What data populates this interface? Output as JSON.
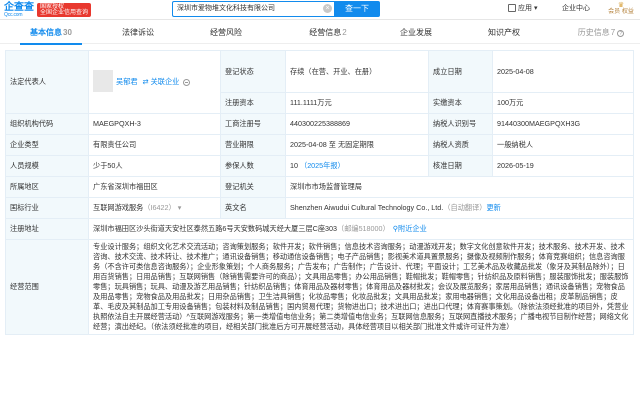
{
  "header": {
    "logo_main": "企查查",
    "logo_sub": "Qcc.com",
    "badge_top": "国家授权",
    "badge_bottom": "全国企业信用查询",
    "search_value": "深圳市爱物堆文化科技有限公司",
    "search_button": "查一下",
    "app_label": "应用",
    "center_label": "企业中心",
    "vip_label": "会员 权益"
  },
  "tabs": [
    {
      "label": "基本信息",
      "count": "30"
    },
    {
      "label": "法律诉讼",
      "count": ""
    },
    {
      "label": "经营风险",
      "count": ""
    },
    {
      "label": "经营信息",
      "count": "2"
    },
    {
      "label": "企业发展",
      "count": ""
    },
    {
      "label": "知识产权",
      "count": ""
    },
    {
      "label": "历史信息",
      "count": "7"
    }
  ],
  "info": {
    "legal_rep_label": "法定代表人",
    "legal_rep_name": "吴郁君",
    "legal_rep_link": "关联企业",
    "status_label": "登记状态",
    "status_value": "存续（在营、开业、在册）",
    "est_date_label": "成立日期",
    "est_date_value": "2025-04-08",
    "reg_capital_label": "注册资本",
    "reg_capital_value": "111.1111万元",
    "paid_capital_label": "实缴资本",
    "paid_capital_value": "100万元",
    "org_code_label": "组织机构代码",
    "org_code_value": "MAEGPQXH-3",
    "biz_reg_label": "工商注册号",
    "biz_reg_value": "440300225388869",
    "taxpayer_id_label": "纳税人识别号",
    "taxpayer_id_value": "91440300MAEGPQXH3G",
    "type_label": "企业类型",
    "type_value": "有限责任公司",
    "term_label": "营业期限",
    "term_value": "2025-04-08 至 无固定期限",
    "taxpayer_q_label": "纳税人资质",
    "taxpayer_q_value": "一般纳税人",
    "staff_label": "人员规模",
    "staff_value": "少于50人",
    "insured_label": "参保人数",
    "insured_value": "10",
    "insured_year": "（2025年报）",
    "approval_label": "核准日期",
    "approval_value": "2026-05-19",
    "region_label": "所属地区",
    "region_value": "广东省深圳市福田区",
    "authority_label": "登记机关",
    "authority_value": "深圳市市场监督管理局",
    "industry_label": "国标行业",
    "industry_value": "互联网游戏服务",
    "industry_code": "（I6422）",
    "english_label": "英文名",
    "english_value": "Shenzhen Aiwudui Cultural Technology Co., Ltd.",
    "english_note": "（自动翻译）",
    "english_update": "更新",
    "address_label": "注册地址",
    "address_value": "深圳市福田区沙头街道天安社区泰然五路6号天安数码城天经大厦三层C座303",
    "address_postcode": "（邮编518000）",
    "address_link": "附近企业",
    "scope_label": "经营范围",
    "scope_value": "专业设计服务；组织文化艺术交流活动；咨询策划服务；软件开发；软件销售；信息技术咨询服务；动漫游戏开发；数字文化创意软件开发；技术服务、技术开发、技术咨询、技术交流、技术转让、技术推广；通讯设备销售；移动通信设备销售；电子产品销售；影视美术道具置景服务；摄像及视频制作服务；体育竞赛组织；信息咨询服务（不含许可类信息咨询服务）；企业形象策划；个人商务服务；广告发布；广告制作；广告设计、代理；平面设计；工艺美术品及收藏品批发（象牙及其制品除外）；日用百货销售；日用品销售；互联网销售（除销售需要许可的商品）；文具用品零售；办公用品销售；鞋帽批发；鞋帽零售；针纺织品及原料销售；服装服饰批发；服装服饰零售；玩具销售；玩具、动漫及游艺用品销售；针纺织品销售；体育用品及器材零售；体育用品及器材批发；会议及展览服务；家居用品销售；通讯设备销售；宠物食品及用品零售；宠物食品及用品批发；日用杂品销售；卫生洁具销售；化妆品零售；化妆品批发；文具用品批发；家用电器销售；文化用品设备出租；皮革制品销售；皮革、毛皮及其制品加工专用设备销售；包装材料及制品销售；国内贸易代理；货物进出口；技术进出口；进出口代理；体育赛事策划。（除依法须经批准的项目外，凭营业执照依法自主开展经营活动）^互联网游戏服务；第一类增值电信业务；第二类增值电信业务；互联网信息服务；互联网直播技术服务；广播电视节目制作经营；网络文化经营；演出经纪。（依法须经批准的项目，经相关部门批准后方可开展经营活动，具体经营项目以相关部门批准文件或许可证件为准）"
  }
}
